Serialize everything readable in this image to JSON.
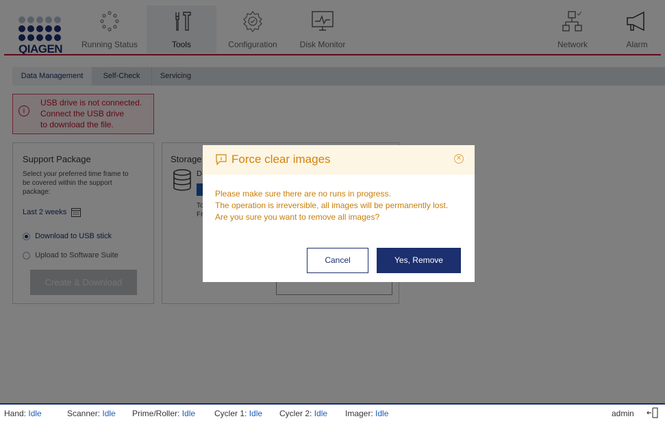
{
  "brand": {
    "name": "QIAGEN"
  },
  "nav": {
    "running_status": "Running Status",
    "tools": "Tools",
    "configuration": "Configuration",
    "disk_monitor": "Disk Monitor",
    "network": "Network",
    "alarm": "Alarm"
  },
  "tabs": {
    "data_management": "Data Management",
    "self_check": "Self-Check",
    "servicing": "Servicing"
  },
  "alert": {
    "line1": "USB drive is not connected.",
    "line2": "Connect the USB drive",
    "line3": "to download the file."
  },
  "support": {
    "title": "Support Package",
    "desc1": "Select your preferred time frame to",
    "desc2": "be covered within the support",
    "desc3": "package:",
    "timeframe": "Last 2 weeks",
    "option_usb": "Download to USB stick",
    "option_suite": "Upload to Software Suite",
    "button": "Create & Download"
  },
  "storage": {
    "title": "Storage",
    "frag_d": "D",
    "frag_to": "To",
    "frag_fr": "Fr"
  },
  "modal": {
    "title": "Force clear images",
    "line1": "Please make sure there are no runs in progress.",
    "line2": "The operation is irreversible, all images will be permanently lost.",
    "line3": "Are you sure you want to remove all images?",
    "cancel": "Cancel",
    "confirm": "Yes, Remove"
  },
  "status": {
    "hand_label": "Hand:",
    "hand_value": "Idle",
    "scanner_label": "Scanner:",
    "scanner_value": "Idle",
    "prime_label": "Prime/Roller:",
    "prime_value": "Idle",
    "cycler1_label": "Cycler 1:",
    "cycler1_value": "Idle",
    "cycler2_label": "Cycler 2:",
    "cycler2_value": "Idle",
    "imager_label": "Imager:",
    "imager_value": "Idle",
    "user": "admin"
  },
  "colors": {
    "brand_blue": "#1c2f6e",
    "accent_red": "#c0142e",
    "warning_orange": "#d4820f"
  }
}
